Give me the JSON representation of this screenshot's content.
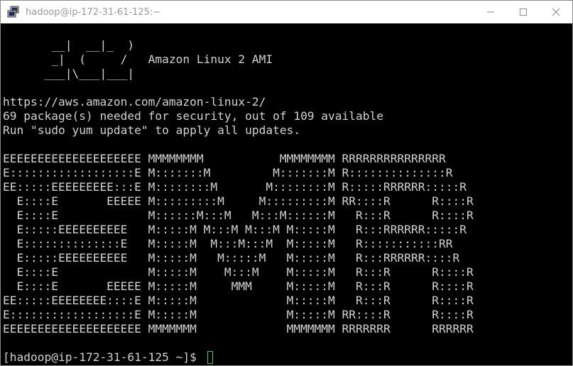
{
  "window": {
    "title": "hadoop@ip-172-31-61-125:~",
    "app_icon": "putty-icon",
    "controls": [
      "minimize-icon",
      "maximize-icon",
      "close-icon"
    ]
  },
  "terminal": {
    "banner_text": "       __|  __|_  )\n       _|  (     /   Amazon Linux 2 AMI\n      ___|\\___|___|\n\nhttps://aws.amazon.com/amazon-linux-2/\n69 package(s) needed for security, out of 109 available\nRun \"sudo yum update\" to apply all updates.\n\nEEEEEEEEEEEEEEEEEEEE MMMMMMMM           MMMMMMMM RRRRRRRRRRRRRRR\nE::::::::::::::::::E M:::::::M         M:::::::M R::::::::::::::R\nEE:::::EEEEEEEEE:::E M::::::::M       M::::::::M R:::::RRRRRR:::::R\n  E::::E       EEEEE M:::::::::M     M:::::::::M RR::::R      R::::R\n  E::::E             M::::::M:::M   M:::M::::::M   R:::R      R::::R\n  E:::::EEEEEEEEEE   M:::::M M:::M M:::M M:::::M   R:::RRRRRR:::::R\n  E::::::::::::::E   M:::::M  M:::M:::M  M:::::M   R:::::::::::RR\n  E:::::EEEEEEEEEE   M:::::M   M:::::M   M:::::M   R:::RRRRRR::::R\n  E::::E             M:::::M    M:::M    M:::::M   R:::R      R::::R\n  E::::E       EEEEE M:::::M     MMM     M:::::M   R:::R      R::::R\nEE:::::EEEEEEEE::::E M:::::M             M:::::M   R:::R      R::::R\nE::::::::::::::::::E M:::::M             M:::::M RR::::R      R::::R\nEEEEEEEEEEEEEEEEEEEE MMMMMMM             MMMMMMM RRRRRRR      RRRRRR\n\n[hadoop@ip-172-31-61-125 ~]$ "
  },
  "colors": {
    "background": "#000000",
    "foreground": "#d2d2d2",
    "cursor": "#34d058",
    "titlebar": "#ffffff",
    "title_text": "#9a9a9a"
  }
}
